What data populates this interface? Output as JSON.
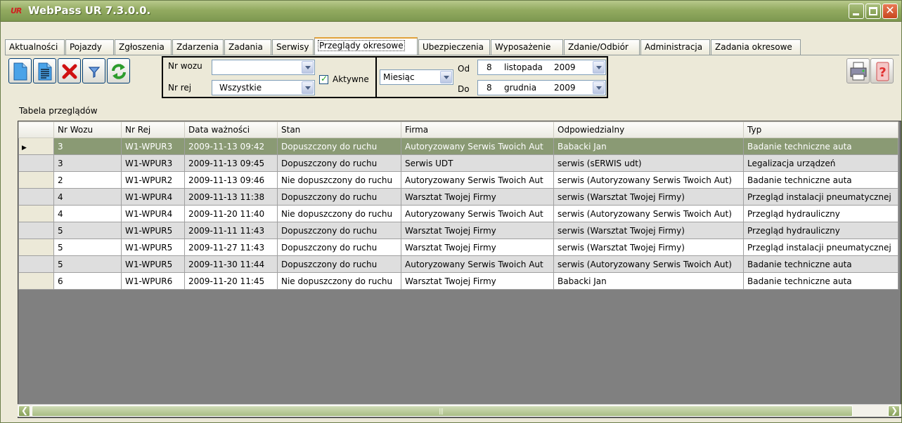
{
  "window": {
    "title": "WebPass UR 7.3.0.0.",
    "logo_text": "UR"
  },
  "tabs": [
    {
      "label": "Aktualności"
    },
    {
      "label": "Pojazdy"
    },
    {
      "label": "Zgłoszenia"
    },
    {
      "label": "Zdarzenia"
    },
    {
      "label": "Zadania"
    },
    {
      "label": "Serwisy"
    },
    {
      "label": "Przeglądy okresowe",
      "active": true
    },
    {
      "label": "Ubezpieczenia"
    },
    {
      "label": "Wyposażenie"
    },
    {
      "label": "Zdanie/Odbiór"
    },
    {
      "label": "Administracja"
    },
    {
      "label": "Zadania okresowe"
    }
  ],
  "toolbar": {
    "icons": [
      "new-document-icon",
      "edit-document-icon",
      "delete-icon",
      "filter-icon",
      "refresh-icon"
    ],
    "right_icons": [
      "print-icon",
      "help-icon"
    ]
  },
  "filters": {
    "nr_wozu_label": "Nr wozu",
    "nr_wozu_value": "",
    "nr_rej_label": "Nr rej",
    "nr_rej_value": "Wszystkie",
    "aktywne_label": "Aktywne",
    "aktywne_checked": true,
    "period_value": "Miesiąc",
    "od_label": "Od",
    "od_day": "8",
    "od_month": "listopada",
    "od_year": "2009",
    "do_label": "Do",
    "do_day": "8",
    "do_month": "grudnia",
    "do_year": "2009"
  },
  "caption": "Tabela przeglądów",
  "table": {
    "columns": [
      "Nr Wozu",
      "Nr Rej",
      "Data ważności",
      "Stan",
      "Firma",
      "Odpowiedzialny",
      "Typ"
    ],
    "rows": [
      [
        "3",
        "W1-WPUR3",
        "2009-11-13 09:42",
        "Dopuszczony do ruchu",
        "Autoryzowany Serwis Twoich Aut",
        "Babacki Jan",
        "Badanie techniczne auta"
      ],
      [
        "3",
        "W1-WPUR3",
        "2009-11-13 09:45",
        "Dopuszczony do ruchu",
        "Serwis UDT",
        "serwis (sERWIS udt)",
        "Legalizacja urządzeń"
      ],
      [
        "2",
        "W1-WPUR2",
        "2009-11-13 09:46",
        "Nie dopuszczony do ruchu",
        "Autoryzowany Serwis Twoich Aut",
        "serwis (Autoryzowany Serwis Twoich Aut)",
        "Badanie techniczne auta"
      ],
      [
        "4",
        "W1-WPUR4",
        "2009-11-13 11:38",
        "Dopuszczony do ruchu",
        "Warsztat Twojej Firmy",
        "serwis (Warsztat Twojej Firmy)",
        "Przegląd instalacji pneumatycznej"
      ],
      [
        "4",
        "W1-WPUR4",
        "2009-11-20 11:40",
        "Nie dopuszczony do ruchu",
        "Autoryzowany Serwis Twoich Aut",
        "serwis (Autoryzowany Serwis Twoich Aut)",
        "Przegląd hydrauliczny"
      ],
      [
        "5",
        "W1-WPUR5",
        "2009-11-11 11:43",
        "Dopuszczony do ruchu",
        "Warsztat Twojej Firmy",
        "serwis (Warsztat Twojej Firmy)",
        "Przegląd hydrauliczny"
      ],
      [
        "5",
        "W1-WPUR5",
        "2009-11-27 11:43",
        "Dopuszczony do ruchu",
        "Warsztat Twojej Firmy",
        "serwis (Warsztat Twojej Firmy)",
        "Przegląd instalacji pneumatycznej"
      ],
      [
        "5",
        "W1-WPUR5",
        "2009-11-30 11:44",
        "Dopuszczony do ruchu",
        "Autoryzowany Serwis Twoich Aut",
        "serwis (Autoryzowany Serwis Twoich Aut)",
        "Badanie techniczne auta"
      ],
      [
        "6",
        "W1-WPUR6",
        "2009-11-20 11:45",
        "Nie dopuszczony do ruchu",
        "Warsztat Twojej Firmy",
        "Babacki Jan",
        "Badanie techniczne auta"
      ]
    ],
    "selected_row": 0
  },
  "colors": {
    "titlebar": "#93ab61",
    "selected_row": "#8a9a74",
    "alt_row": "#dedede",
    "grid_empty": "#808080"
  }
}
